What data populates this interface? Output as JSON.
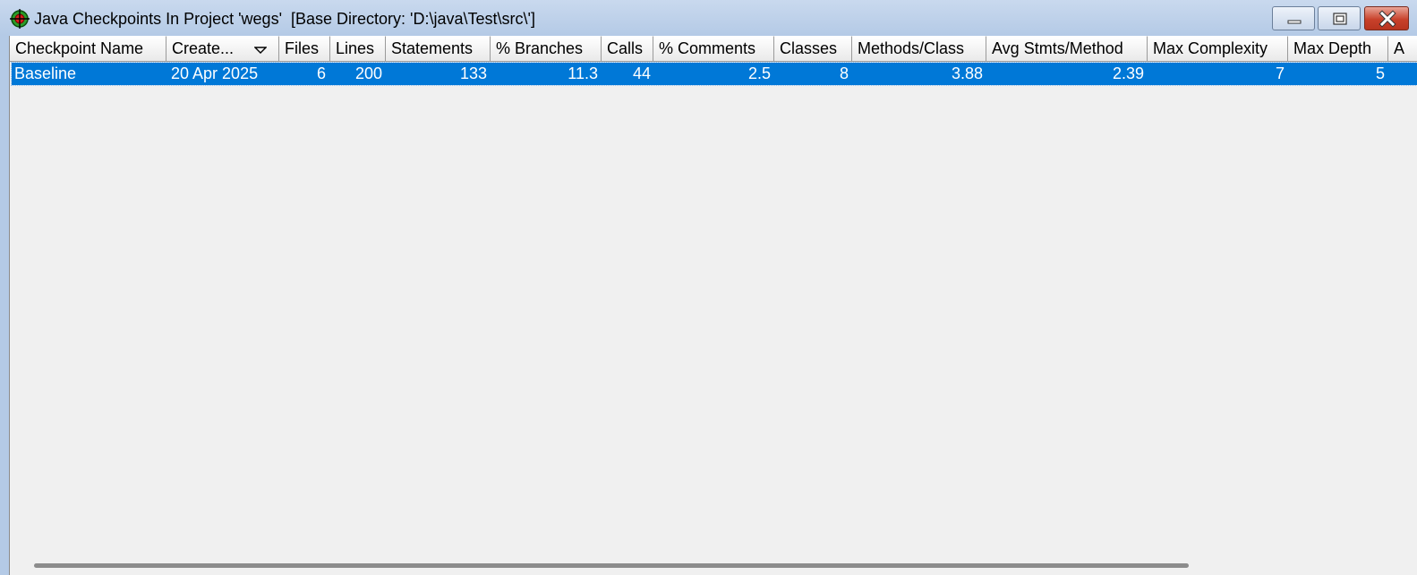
{
  "window": {
    "title": "Java Checkpoints In Project 'wegs'  [Base Directory: 'D:\\java\\Test\\src\\']",
    "icon": "crosshair-target-icon",
    "buttons": [
      "minimize-icon",
      "maximize-icon",
      "close-icon"
    ]
  },
  "table": {
    "columns": [
      "Checkpoint Name",
      "Create...",
      "Files",
      "Lines",
      "Statements",
      "% Branches",
      "Calls",
      "% Comments",
      "Classes",
      "Methods/Class",
      "Avg Stmts/Method",
      "Max Complexity",
      "Max Depth",
      "A"
    ],
    "sorted_column": "Create...",
    "sort_direction": "descending",
    "rows": [
      {
        "name": "Baseline",
        "created": "20 Apr 2025",
        "files": "6",
        "lines": "200",
        "statements": "133",
        "branches": "11.3",
        "calls": "44",
        "comments": "2.5",
        "classes": "8",
        "methods_per_class": "3.88",
        "avg_stmts_per_method": "2.39",
        "max_complexity": "7",
        "max_depth": "5"
      }
    ],
    "selected_row": 0
  },
  "colors": {
    "selection": "#0078d7",
    "close_button": "#c8412b"
  }
}
